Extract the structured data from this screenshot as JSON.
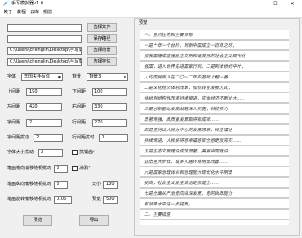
{
  "window": {
    "title": "手写模拟器v1.0",
    "min_glyph": "—",
    "max_glyph": "☐",
    "close_glyph": "✕"
  },
  "menu": {
    "items": [
      "关于",
      "教程",
      "云库",
      "捐赠"
    ]
  },
  "files": {
    "file_input": "",
    "save_input": "",
    "background_path": "C:\\Users\\chenglin\\Desktop\\手写模",
    "font_path": "C:\\Users\\chenglin\\Desktop\\手写模",
    "choose_file_btn": "选择文件",
    "save_path_btn": "保存路径",
    "choose_bg_btn": "选择背景",
    "choose_font_btn": "选择字体"
  },
  "font": {
    "label": "字体",
    "value": "李国夫手写体",
    "bg_label": "背景",
    "bg_value": "背景3"
  },
  "params": {
    "top_margin_label": "上间距",
    "top_margin": "190",
    "bottom_margin_label": "下间距",
    "bottom_margin": "100",
    "left_margin_label": "左间距",
    "left_margin": "420",
    "right_margin_label": "右间距",
    "right_margin": "330",
    "char_spacing_label": "字间距",
    "char_spacing": "2",
    "line_spacing_label": "行间距",
    "line_spacing": "270",
    "char_jitter_label": "字间距扰动",
    "char_jitter": "2",
    "line_jitter_label": "行间距扰动",
    "line_jitter": "0",
    "font_size_jitter_label": "字体大小扰动",
    "font_size_jitter": "2",
    "antialias_label": "抗锯齿*",
    "stroke_h_label": "笔画横向偏移随机扰动",
    "stroke_h": "3",
    "smear_label": "涂鸦*",
    "stroke_v_label": "笔画纵向偏移随机扰动",
    "stroke_v": "3",
    "size_label": "大小",
    "size": "130",
    "stroke_rot_label": "笔画旋转偏移随机扰动",
    "stroke_rot": "0.05",
    "dpi_label": "预览",
    "dpi": "500"
  },
  "actions": {
    "preview": "预览",
    "export": "导出"
  },
  "preview": {
    "caption": "预览",
    "lines": [
      "一、重点任务和主要目标",
      "    一是十年一个台阶，到新中国成立一百年之时，",
      "把我国建成富强民主文明和谐美丽的社会主义现代化",
      "强国，进入世界先进国家行列。二是到本世纪中叶，",
      "人均国民收入在二〇一二年的基础上翻一番……",
      "    二是深化经济体制改革，加快转变发展方式，",
      "供给侧结构性改革持续推进，实体经济不断壮大……",
      "    三是创新驱动发展战略深入实施，科技实力",
      "显著增强，高质量发展取得新成效……",
      "    四是坚持以人民为中心的发展思想，民生福祉",
      "持续增进，人民获得感幸福感安全感更加充实……",
      "    五是生态文明建设成效显著，美丽中国建设",
      "迈出重大步伐，城乡人居环境明显改善……",
      "    六是国家治理体系和治理能力现代化水平明显",
      "提高，社会主义民主法治更加健全……",
      "    七是全面从严治党向纵深发展，党的执政能力",
      "和领导水平进一步提高。",
      "二、主要措施"
    ]
  }
}
